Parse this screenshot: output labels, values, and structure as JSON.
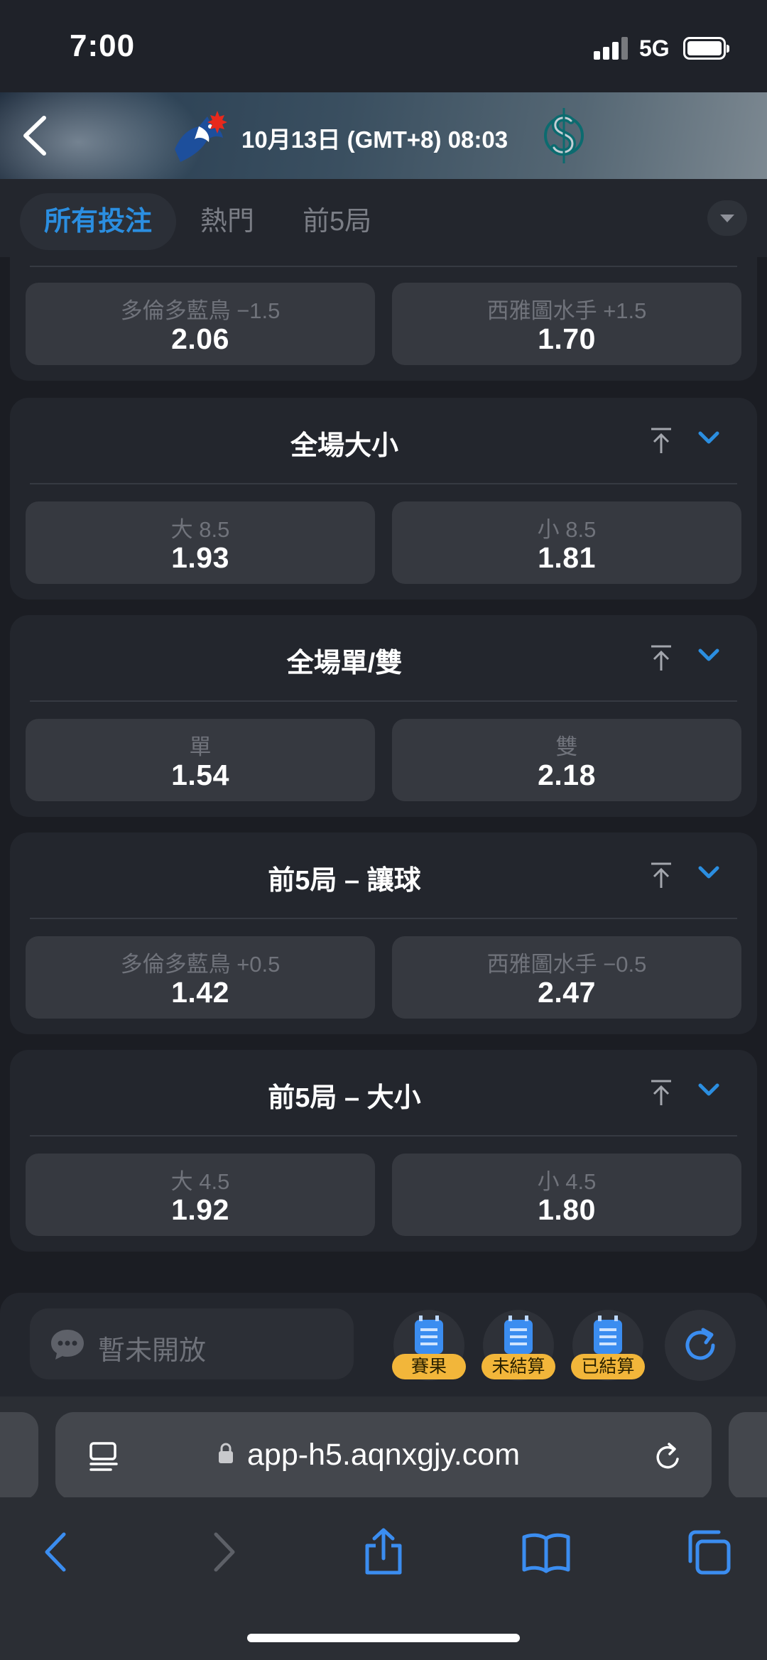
{
  "status_bar": {
    "time": "7:00",
    "network": "5G"
  },
  "match": {
    "datetime": "10月13日 (GMT+8)  08:03"
  },
  "tabs": [
    {
      "label": "所有投注",
      "active": true
    },
    {
      "label": "熱門"
    },
    {
      "label": "前5局"
    }
  ],
  "markets": [
    {
      "title": "",
      "options": [
        {
          "label": "多倫多藍鳥 −1.5",
          "odds": "2.06"
        },
        {
          "label": "西雅圖水手 +1.5",
          "odds": "1.70"
        }
      ]
    },
    {
      "title": "全場大小",
      "options": [
        {
          "label": "大 8.5",
          "odds": "1.93"
        },
        {
          "label": "小 8.5",
          "odds": "1.81"
        }
      ]
    },
    {
      "title": "全場單/雙",
      "options": [
        {
          "label": "單",
          "odds": "1.54"
        },
        {
          "label": "雙",
          "odds": "2.18"
        }
      ]
    },
    {
      "title": "前5局 – 讓球",
      "options": [
        {
          "label": "多倫多藍鳥 +0.5",
          "odds": "1.42"
        },
        {
          "label": "西雅圖水手 −0.5",
          "odds": "2.47"
        }
      ]
    },
    {
      "title": "前5局 – 大小",
      "options": [
        {
          "label": "大 4.5",
          "odds": "1.92"
        },
        {
          "label": "小 4.5",
          "odds": "1.80"
        }
      ]
    }
  ],
  "action_bar": {
    "chat_placeholder": "暫未開放",
    "results_label": "賽果",
    "unsettled_label": "未結算",
    "settled_label": "已結算"
  },
  "browser": {
    "url": "app-h5.aqnxgjy.com"
  },
  "colors": {
    "accent": "#2b8ee0",
    "badge": "#f2b63a",
    "background": "#1b1d23",
    "card": "#23262d",
    "button": "#363940"
  },
  "icons": [
    "back-icon",
    "blue-jays-logo",
    "mariners-logo",
    "pin-top-icon",
    "chevron-down-icon",
    "chat-bubble-icon",
    "clipboard-icon",
    "refresh-icon",
    "reader-icon",
    "lock-icon",
    "reload-icon",
    "share-icon",
    "bookmarks-icon",
    "tabs-icon"
  ]
}
